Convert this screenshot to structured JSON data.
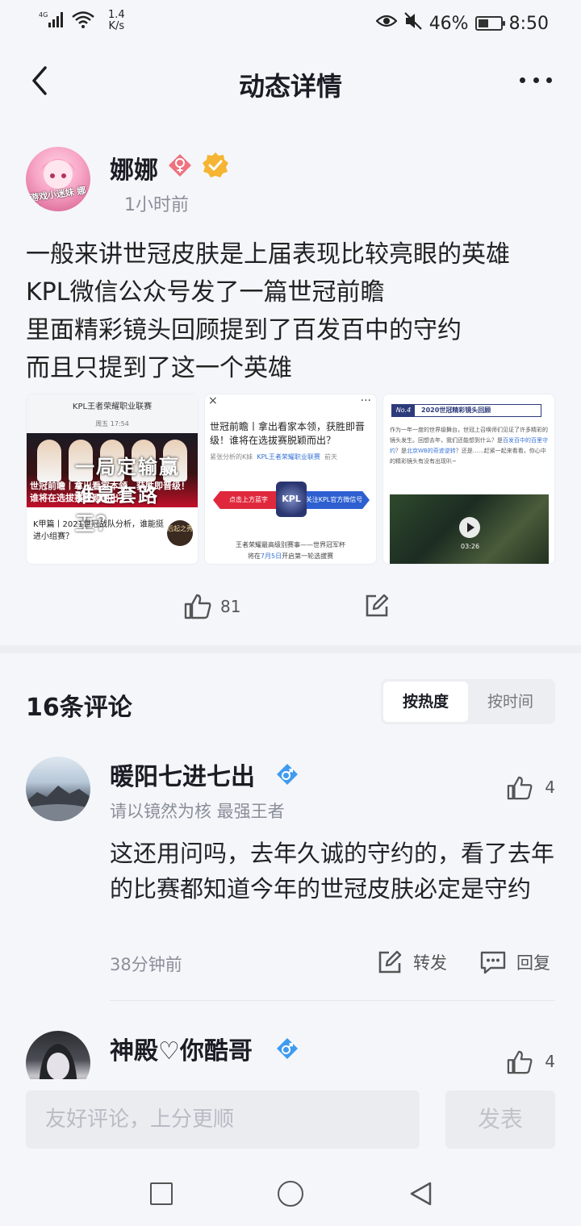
{
  "status_bar": {
    "signal": "4G",
    "speed_value": "1.4",
    "speed_unit": "K/s",
    "battery": "46%",
    "battery_level": 0.46,
    "time": "8:50"
  },
  "header": {
    "title": "动态详情"
  },
  "post": {
    "author": "娜娜",
    "avatar_text": "游戏小迷妹 娜娜",
    "time": "1小时前",
    "lines": [
      "一般来讲世冠皮肤是上届表现比较亮眼的英雄",
      "KPL微信公众号发了一篇世冠前瞻",
      "里面精彩镜头回顾提到了百发百中的守约",
      "而且只提到了这一个英雄"
    ],
    "images": {
      "img1": {
        "header": "KPL王者荣耀职业联赛",
        "date": "周五 17:54",
        "slogan": "一局定输赢 谁是套路王？",
        "caption": "世冠前瞻丨拿出看家本领，获胜即晋级！谁将在选拔赛脱颖而出？",
        "bottom": "K甲篇丨2021世冠战队分析，谁能挺进小组赛？",
        "logo_text": "后起之秀"
      },
      "img2": {
        "close": "×",
        "dots": "···",
        "title": "世冠前瞻丨拿出看家本领，获胜即晋级！谁将在选拔赛脱颖而出？",
        "meta_author": "紧张分析的K妹",
        "meta_source": "KPL王者荣耀职业联赛",
        "meta_time": "前天",
        "banner_left": "点击上方蓝字",
        "banner_center": "KPL",
        "banner_right": "关注KPL官方微信号",
        "foot_1": "王者荣耀最高级别赛事——世界冠军杯",
        "foot_2a": "将在",
        "foot_2b": "7月5日",
        "foot_2c": "开启第一轮选拔赛"
      },
      "img3": {
        "no": "No.4",
        "title": "2020世冠精彩镜头回顾",
        "body_1": "作为一年一度的世界级舞台，世冠上召唤师们见证了许多精彩的镜头发生。回想去年，我们还能想到什么？是",
        "body_link1": "百发百中的百里守约",
        "body_2": "？是",
        "body_link2": "北京WB的奇迹逆转",
        "body_3": "？还是……赶紧一起来看看，你心中的精彩镜头有没有出现叭~",
        "duration": "03:26"
      }
    },
    "likes": "81"
  },
  "comments_section": {
    "title": "16条评论",
    "sort_hot": "按热度",
    "sort_time": "按时间",
    "comments": [
      {
        "name": "暖阳七进七出",
        "subtitle": "请以镜然为核 最强王者",
        "text": "这还用问吗，去年久诚的守约的，看了去年的比赛都知道今年的世冠皮肤必定是守约",
        "time": "38分钟前",
        "likes": "4",
        "repost": "转发",
        "reply": "回复"
      },
      {
        "name": "神殿♡你酷哥",
        "subtitle": "…",
        "likes": "4"
      }
    ]
  },
  "input_bar": {
    "placeholder": "友好评论，上分更顺",
    "send": "发表"
  },
  "colors": {
    "female": "#f0727f",
    "verified": "#f5b533",
    "male": "#3f9bf0"
  }
}
